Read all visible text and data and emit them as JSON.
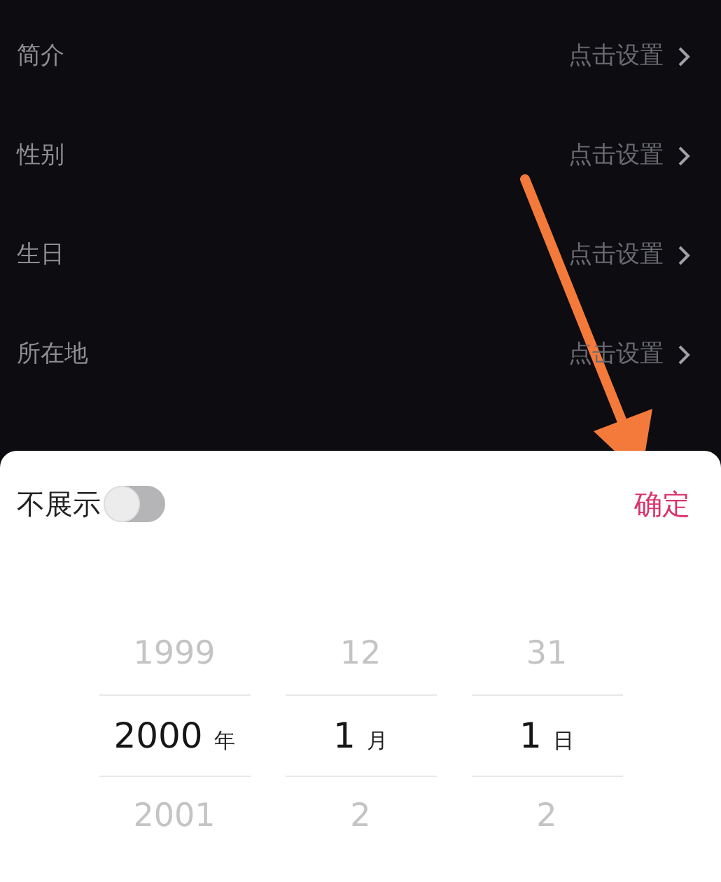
{
  "profile_rows": [
    {
      "label": "简介",
      "value": "点击设置"
    },
    {
      "label": "性别",
      "value": "点击设置"
    },
    {
      "label": "生日",
      "value": "点击设置"
    },
    {
      "label": "所在地",
      "value": "点击设置"
    }
  ],
  "sheet": {
    "hide_label": "不展示",
    "hide_toggle": {
      "on": false
    },
    "confirm": "确定",
    "picker": {
      "columns": [
        {
          "unit": "年",
          "items": [
            {
              "value": "1999",
              "selected": false
            },
            {
              "value": "2000",
              "selected": true
            },
            {
              "value": "2001",
              "selected": false
            }
          ]
        },
        {
          "unit": "月",
          "items": [
            {
              "value": "12",
              "selected": false
            },
            {
              "value": "1",
              "selected": true
            },
            {
              "value": "2",
              "selected": false
            }
          ]
        },
        {
          "unit": "日",
          "items": [
            {
              "value": "31",
              "selected": false
            },
            {
              "value": "1",
              "selected": true
            },
            {
              "value": "2",
              "selected": false
            }
          ]
        }
      ]
    }
  }
}
